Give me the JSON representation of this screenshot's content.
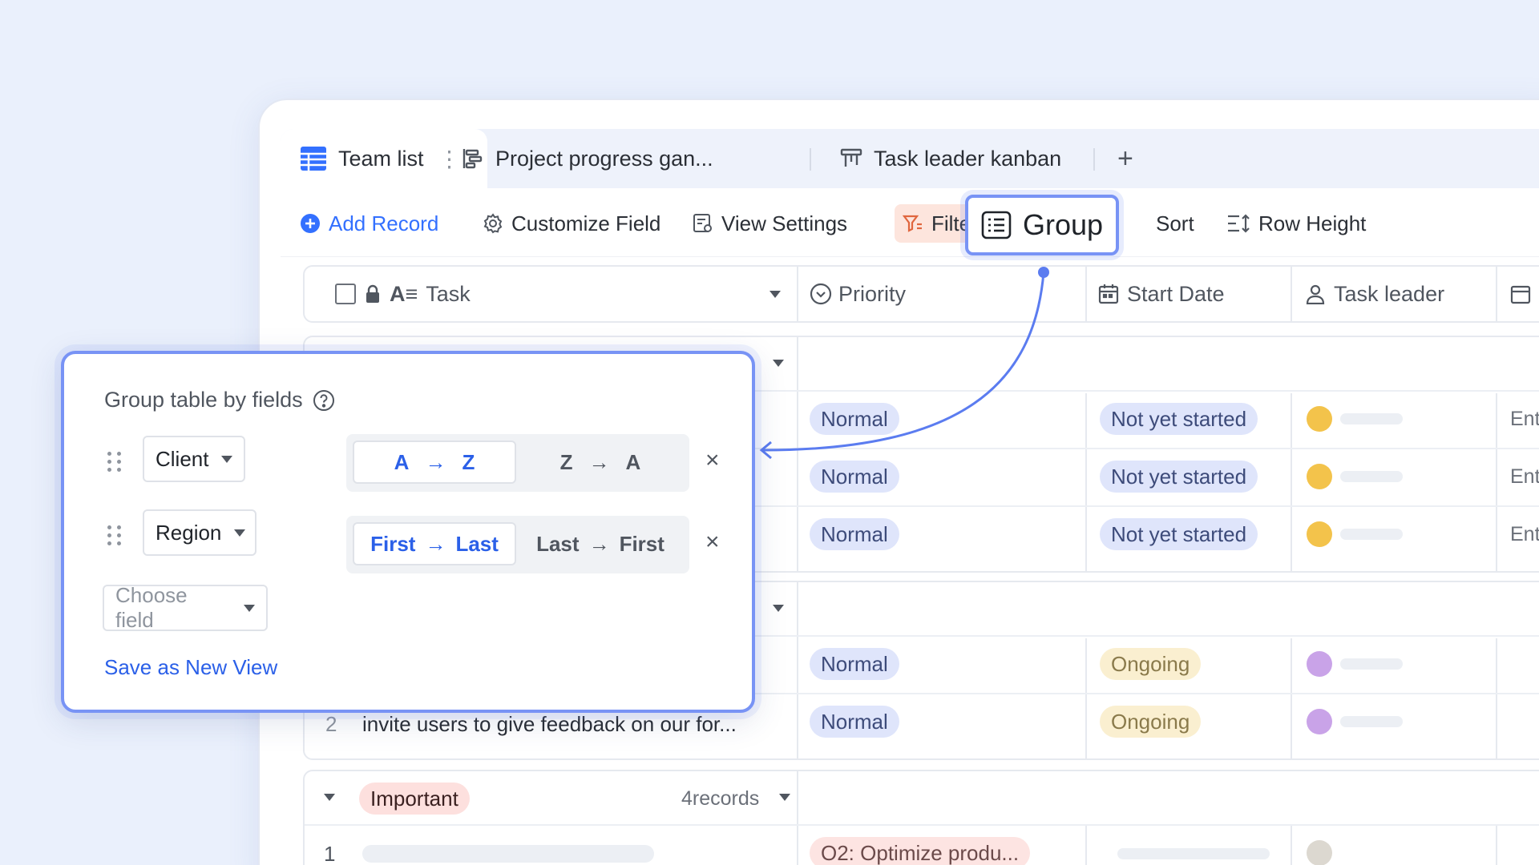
{
  "tabs": {
    "team_list": "Team list",
    "project_gantt": "Project progress gan...",
    "task_kanban": "Task leader kanban",
    "add": "+"
  },
  "toolbar": {
    "add_record": "Add Record",
    "customize_field": "Customize Field",
    "view_settings": "View Settings",
    "filter": "Filter",
    "group": "Group",
    "sort": "Sort",
    "row_height": "Row Height"
  },
  "columns": {
    "task": "Task",
    "priority": "Priority",
    "start_date": "Start Date",
    "task_leader": "Task leader"
  },
  "rows_group1": [
    {
      "priority": "Normal",
      "status": "Not yet started",
      "extra": "Ent"
    },
    {
      "priority": "Normal",
      "status": "Not yet started",
      "extra": "Ent"
    },
    {
      "priority": "Normal",
      "status": "Not yet started",
      "extra": "Ent"
    }
  ],
  "rows_group2": [
    {
      "priority": "Normal",
      "status": "Ongoing",
      "index": "2",
      "task": "invite users to give feedback on our for..."
    },
    {
      "priority": "Normal",
      "status": "Ongoing"
    }
  ],
  "group3": {
    "label": "Important",
    "count": "4records",
    "row_index": "1",
    "row_priority": "O2: Optimize produ..."
  },
  "popup": {
    "title": "Group table by fields",
    "field1": "Client",
    "field2": "Region",
    "choose_placeholder": "Choose field",
    "az_a": "A",
    "az_z": "Z",
    "za_z": "Z",
    "za_a": "A",
    "first": "First",
    "last": "Last",
    "last2": "Last",
    "first2": "First",
    "arrow": "→",
    "close": "×",
    "save_link": "Save as New View"
  },
  "colors": {
    "accent": "#3370ff",
    "highlight_border": "#7893f5",
    "filter_bg": "#fde5dd"
  }
}
